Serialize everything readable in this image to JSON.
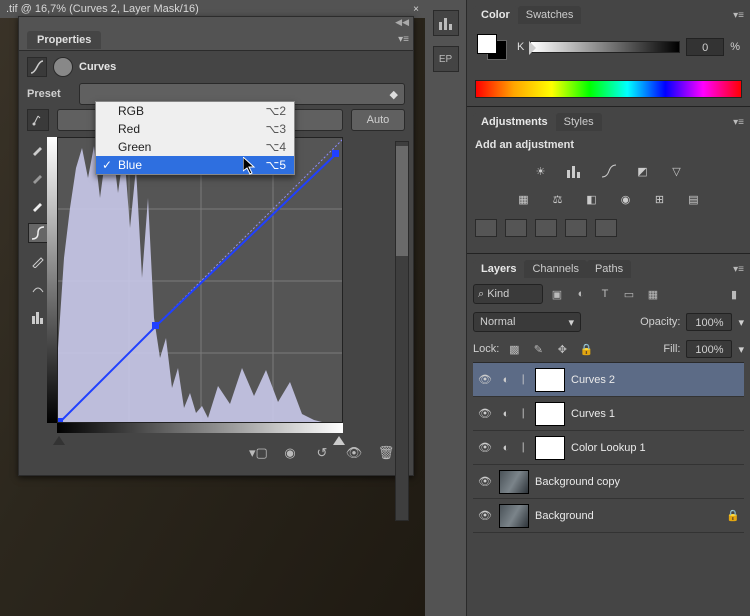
{
  "doc_tab": {
    "title": ".tif @ 16,7% (Curves 2, Layer Mask/16)"
  },
  "properties": {
    "panel_title": "Properties",
    "section": "Curves",
    "preset_label": "Preset",
    "auto_label": "Auto",
    "dropdown": {
      "options": [
        {
          "label": "RGB",
          "shortcut": "⌥2"
        },
        {
          "label": "Red",
          "shortcut": "⌥3"
        },
        {
          "label": "Green",
          "shortcut": "⌥4"
        },
        {
          "label": "Blue",
          "shortcut": "⌥5"
        }
      ],
      "selected_index": 3
    }
  },
  "color_panel": {
    "tab_color": "Color",
    "tab_swatches": "Swatches",
    "k_label": "K",
    "k_value": "0",
    "k_unit": "%"
  },
  "adjustments_panel": {
    "tab_adjustments": "Adjustments",
    "tab_styles": "Styles",
    "hint": "Add an adjustment"
  },
  "layers_panel": {
    "tab_layers": "Layers",
    "tab_channels": "Channels",
    "tab_paths": "Paths",
    "kind_label": "⌕ Kind",
    "blend_mode": "Normal",
    "opacity_label": "Opacity:",
    "opacity_value": "100%",
    "lock_label": "Lock:",
    "fill_label": "Fill:",
    "fill_value": "100%",
    "layers": [
      {
        "name": "Curves 2",
        "type": "adj",
        "selected": true
      },
      {
        "name": "Curves 1",
        "type": "adj",
        "selected": false
      },
      {
        "name": "Color Lookup 1",
        "type": "adj",
        "selected": false
      },
      {
        "name": "Background copy",
        "type": "img",
        "selected": false
      },
      {
        "name": "Background",
        "type": "img",
        "selected": false,
        "locked": true
      }
    ]
  },
  "side_icons": {
    "ep_label": "EP"
  }
}
